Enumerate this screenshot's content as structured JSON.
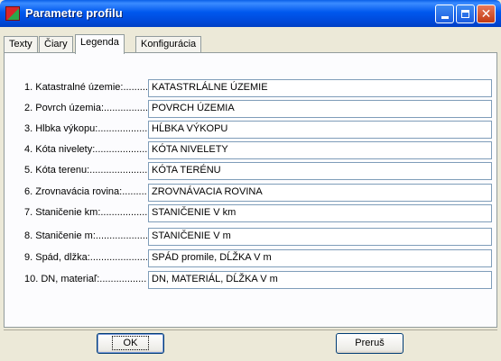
{
  "window": {
    "title": "Parametre profilu",
    "app_icon": "profile-app-icon",
    "controls": {
      "minimize": "minimize-icon",
      "maximize": "maximize-icon",
      "close": "close-icon",
      "close_glyph": "✕"
    }
  },
  "tabs": [
    {
      "label": "Texty"
    },
    {
      "label": "Čiary"
    },
    {
      "label": "Legenda",
      "active": true
    },
    {
      "label": "Konfigurácia"
    }
  ],
  "rows": [
    {
      "label": "1. Katastralné územie:.........",
      "value": "KATASTRLÁLNE ÚZEMIE"
    },
    {
      "label": "2. Povrch územia:.....................",
      "value": "POVRCH ÚZEMIA"
    },
    {
      "label": "3. Hĺbka výkopu:...................",
      "value": "HĹBKA VÝKOPU"
    },
    {
      "label": "4. Kóta nivelety:....................",
      "value": "KÓTA NIVELETY"
    },
    {
      "label": "5. Kóta terenu:........................",
      "value": "KÓTA TERÉNU"
    },
    {
      "label": "6. Zrovnavácia rovina:..........",
      "value": "ZROVNÁVACIA ROVINA"
    },
    {
      "label": "7. Staničenie km:..................",
      "value": "STANIČENIE V km"
    },
    {
      "label": "8. Staničenie m:.....................",
      "value": "STANIČENIE V m"
    },
    {
      "label": "9. Spád, dĺžka:........................",
      "value": "SPÁD promile, DĹŽKA V m"
    },
    {
      "label": "10. DN, materiaľ:...................",
      "value": "DN, MATERIÁL, DĹŽKA V m"
    }
  ],
  "buttons": {
    "ok": "OK",
    "cancel": "Preruš"
  }
}
